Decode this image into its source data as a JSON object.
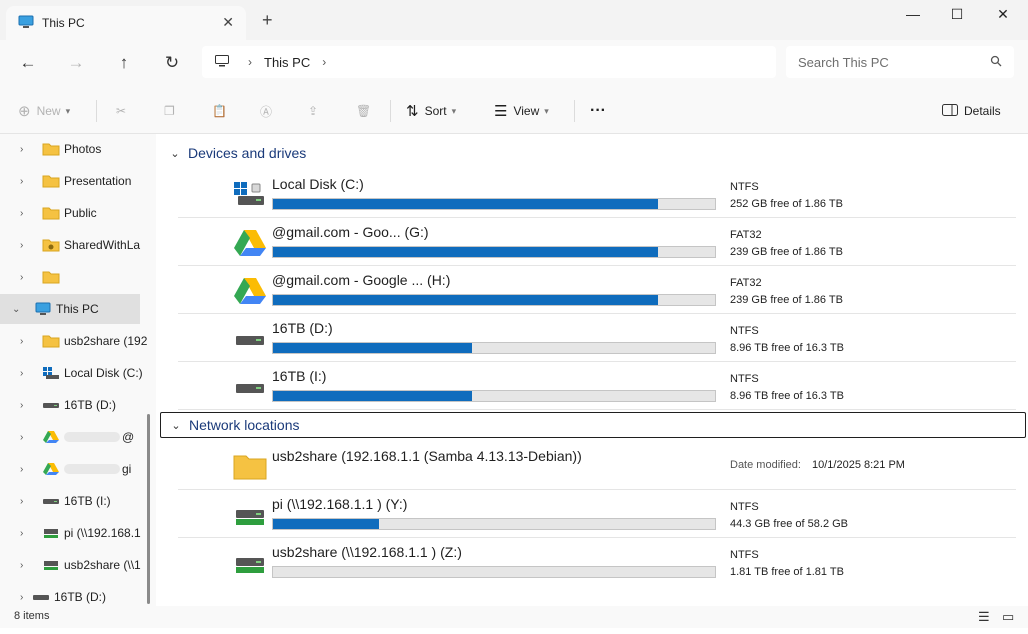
{
  "window": {
    "tab_title": "This PC",
    "tab_close": "✕",
    "new_tab": "+",
    "minimize": "—",
    "maximize": "☐",
    "close": "✕"
  },
  "address": {
    "crumb": "This PC",
    "search_placeholder": "Search This PC"
  },
  "toolbar": {
    "new_label": "New",
    "sort_label": "Sort",
    "view_label": "View",
    "more_label": "···",
    "details_label": "Details"
  },
  "sidebar": {
    "items": [
      {
        "label": "Photos",
        "icon": "folder-icon"
      },
      {
        "label": "Presentation",
        "icon": "folder-icon"
      },
      {
        "label": "Public",
        "icon": "folder-icon"
      },
      {
        "label": "SharedWithLa",
        "icon": "shared-folder-icon"
      },
      {
        "label": "",
        "icon": "folder-icon"
      },
      {
        "label": "This PC",
        "icon": "computer-icon"
      },
      {
        "label": "usb2share (192",
        "icon": "folder-icon"
      },
      {
        "label": "Local Disk (C:)",
        "icon": "windows-drive-icon"
      },
      {
        "label": "16TB (D:)",
        "icon": "drive-icon"
      },
      {
        "label": "@",
        "icon": "google-drive-icon"
      },
      {
        "label": "gi",
        "icon": "google-drive-icon"
      },
      {
        "label": "16TB (I:)",
        "icon": "drive-icon"
      },
      {
        "label": "pi (\\\\192.168.1",
        "icon": "network-drive-icon"
      },
      {
        "label": "usb2share (\\\\1",
        "icon": "network-drive-icon"
      },
      {
        "label": "16TB (D:)",
        "icon": "drive-icon"
      }
    ]
  },
  "groups": {
    "devices": "Devices and drives",
    "network": "Network locations"
  },
  "drives": [
    {
      "name": "Local Disk (C:)",
      "fs": "NTFS",
      "free": "252 GB free of 1.86 TB",
      "used_fraction": 0.87,
      "icon": "windows-drive-icon"
    },
    {
      "name": "@gmail.com - Goo... (G:)",
      "fs": "FAT32",
      "free": "239 GB free of 1.86 TB",
      "used_fraction": 0.87,
      "icon": "google-drive-icon"
    },
    {
      "name": "@gmail.com - Google ... (H:)",
      "fs": "FAT32",
      "free": "239 GB free of 1.86 TB",
      "used_fraction": 0.87,
      "icon": "google-drive-icon"
    },
    {
      "name": "16TB (D:)",
      "fs": "NTFS",
      "free": "8.96 TB free of 16.3 TB",
      "used_fraction": 0.45,
      "icon": "drive-icon"
    },
    {
      "name": "16TB (I:)",
      "fs": "NTFS",
      "free": "8.96 TB free of 16.3 TB",
      "used_fraction": 0.45,
      "icon": "drive-icon"
    }
  ],
  "network": [
    {
      "name": "usb2share (192.168.1.1 (Samba 4.13.13-Debian))",
      "date_label": "Date modified:",
      "date_value": "10/1/2025 8:21 PM",
      "icon": "folder-icon"
    },
    {
      "name": "pi (\\\\192.168.1.1 ) (Y:)",
      "fs": "NTFS",
      "free": "44.3 GB free of 58.2 GB",
      "used_fraction": 0.24,
      "icon": "network-drive-icon"
    },
    {
      "name": "usb2share (\\\\192.168.1.1 ) (Z:)",
      "fs": "NTFS",
      "free": "1.81 TB free of 1.81 TB",
      "used_fraction": 0.0,
      "icon": "network-drive-icon"
    }
  ],
  "status": {
    "count": "8 items"
  },
  "colors": {
    "accent": "#0f6cbd",
    "folder": "#f5c242",
    "group_header": "#1a3a7a"
  }
}
